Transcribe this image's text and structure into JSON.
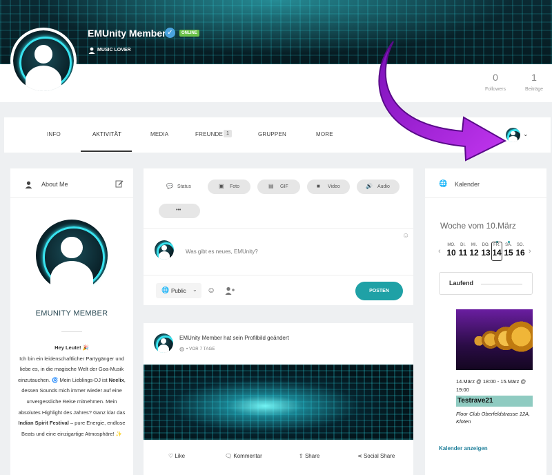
{
  "profile": {
    "name": "EMUnity Member",
    "online_badge": "ONLINE",
    "role": "MUSIC LOVER",
    "stats": [
      {
        "value": "0",
        "label": "Followers"
      },
      {
        "value": "1",
        "label": "Beiträge"
      }
    ]
  },
  "nav": {
    "tabs": [
      "INFO",
      "AKTIVITÄT",
      "MEDIA",
      "FREUNDE",
      "GRUPPEN",
      "MORE"
    ],
    "active": "AKTIVITÄT",
    "friends_count": "1"
  },
  "about": {
    "title": "About Me",
    "name": "EMUNITY MEMBER",
    "bio": {
      "greeting": "Hey Leute! 🎉",
      "p1": "Ich bin ein leidenschaftlicher Partygänger und liebe es, in die magische Welt der Goa-Musik einzutauchen. 🌀 Mein Lieblings-DJ ist ",
      "dj": "Neelix",
      "p2": ", dessen Sounds mich immer wieder auf eine unvergessliche Reise mitnehmen. Mein absolutes Highlight des Jahres? Ganz klar das ",
      "festival": "Indian Spirit Festival",
      "p3": " – pure Energie, endlose Beats und eine einzigartige Atmosphäre! ✨"
    }
  },
  "composer": {
    "tabs": [
      "Status",
      "Foto",
      "GIF",
      "Video",
      "Audio"
    ],
    "more": "•••",
    "placeholder": "Was gibt es neues, EMUnity?",
    "privacy": "Public",
    "post_button": "POSTEN"
  },
  "feed": {
    "author": "EMUnity Member",
    "action": "hat sein Profilbild geändert",
    "time": "VOR 7 TAGE",
    "actions": [
      "Like",
      "Kommentar",
      "Share",
      "Social Share"
    ]
  },
  "calendar": {
    "title": "Kalender",
    "week": "Woche vom 10.März",
    "days": [
      {
        "name": "MO.",
        "date": "10"
      },
      {
        "name": "DI.",
        "date": "11"
      },
      {
        "name": "MI.",
        "date": "12"
      },
      {
        "name": "DO.",
        "date": "13"
      },
      {
        "name": "FR.",
        "date": "14"
      },
      {
        "name": "SA.",
        "date": "15"
      },
      {
        "name": "SO.",
        "date": "16"
      }
    ],
    "filter": "Laufend",
    "event": {
      "time": "14.März @ 18:00 - 15.März @ 19:00",
      "name": "Testrave21",
      "location": "Floor Club Oberfeldstrasse 12A, Kloten"
    },
    "link": "Kalender anzeigen"
  },
  "colors": {
    "accent": "#1fa1a6",
    "online": "#6cc24a",
    "arrow": "#a11ad6"
  }
}
